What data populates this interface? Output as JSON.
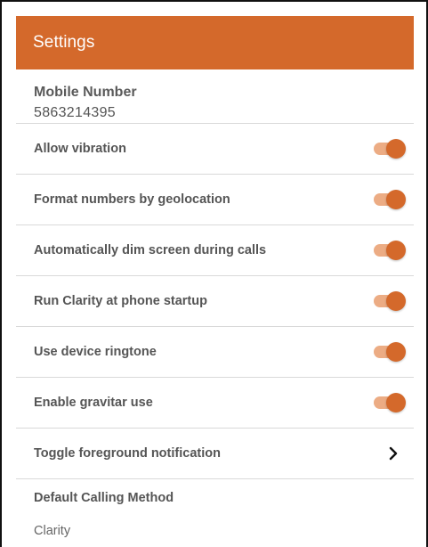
{
  "appbar": {
    "title": "Settings"
  },
  "mobile_number": {
    "label": "Mobile Number",
    "value": "5863214395"
  },
  "toggles": [
    {
      "label": "Allow vibration",
      "enabled": true
    },
    {
      "label": "Format numbers by geolocation",
      "enabled": true
    },
    {
      "label": "Automatically dim screen during calls",
      "enabled": true
    },
    {
      "label": "Run Clarity at phone startup",
      "enabled": true
    },
    {
      "label": "Use device ringtone",
      "enabled": true
    },
    {
      "label": "Enable gravitar use",
      "enabled": true
    }
  ],
  "foreground_notification": {
    "label": "Toggle foreground notification",
    "icon": "chevron-right-icon"
  },
  "calling_method": {
    "label": "Default Calling Method",
    "value": "Clarity"
  },
  "colors": {
    "accent": "#d4692b",
    "switch_track": "#ecac84",
    "divider": "#d9d9d9"
  }
}
